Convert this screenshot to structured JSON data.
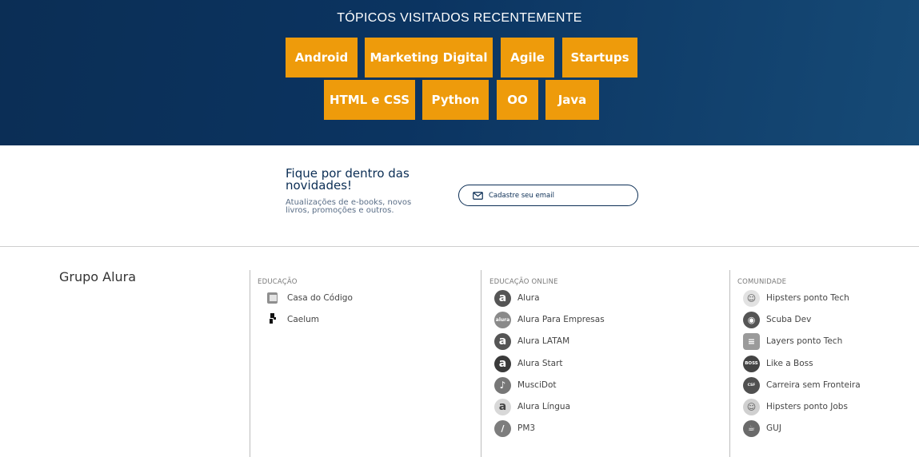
{
  "topics": {
    "title": "TÓPICOS VISITADOS RECENTEMENTE",
    "tag_color": "#ee9b0b",
    "row1": [
      "Android",
      "Marketing Digital",
      "Agile",
      "Startups"
    ],
    "row2": [
      "HTML e CSS",
      "Python",
      "OO",
      "Java"
    ]
  },
  "newsletter": {
    "title": "Fique por dentro das novidades!",
    "subtitle": "Atualizações de e-books, novos livros, promoções e outros.",
    "email_placeholder": "Cadastre seu email",
    "email_icon": "envelope-icon"
  },
  "footer": {
    "brand": "Grupo Alura",
    "educacao": {
      "heading": "EDUCAÇÃO",
      "items": [
        "Casa do Código",
        "Caelum"
      ]
    },
    "educacao_online": {
      "heading": "EDUCAÇÃO ONLINE",
      "items": [
        "Alura",
        "Alura Para Empresas",
        "Alura LATAM",
        "Alura Start",
        "MusciDot",
        "Alura Língua",
        "PM3"
      ]
    },
    "comunidade": {
      "heading": "COMUNIDADE",
      "items": [
        "Hipsters ponto Tech",
        "Scuba Dev",
        "Layers ponto Tech",
        "Like a Boss",
        "Carreira sem Fronteira",
        "Hipsters ponto Jobs",
        "GUJ"
      ]
    }
  }
}
